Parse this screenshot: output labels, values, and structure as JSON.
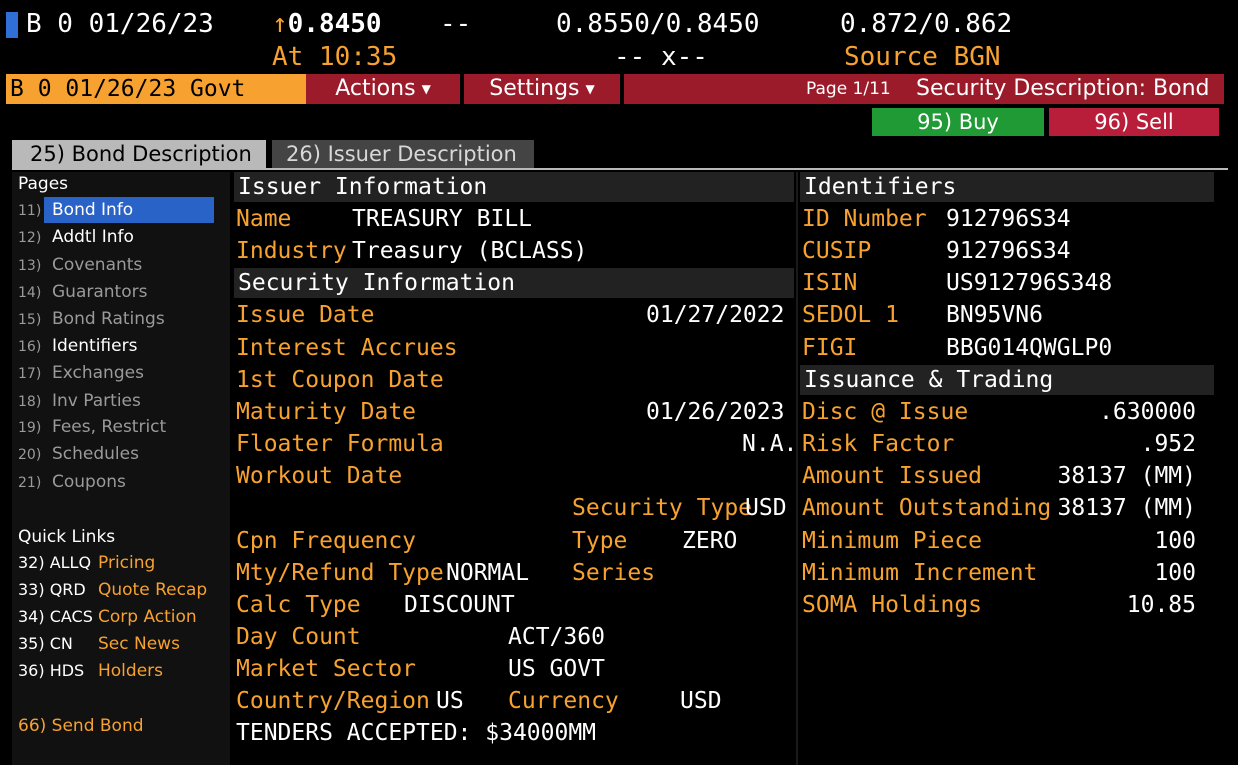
{
  "quote": {
    "ticker": "B 0 01/26/23",
    "arrow": "↑",
    "last_price": "0.8450",
    "change": "--",
    "time_label": "At 10:35",
    "bid": "0.8550",
    "ask": "0.8450",
    "bid_ask_sep": "/",
    "size_line": "-- x--",
    "yield_bid": "0.872",
    "yield_ask": "0.862",
    "source_label": "Source BGN"
  },
  "command_bar": {
    "security": "B 0 01/26/23 Govt",
    "actions": "Actions",
    "settings": "Settings",
    "page": "Page 1/11",
    "title": "Security Description: Bond",
    "buy": "95) Buy",
    "sell": "96) Sell",
    "accent": "#f7a230",
    "bar_color": "#9b1b2a"
  },
  "tabs": [
    {
      "label": "25) Bond Description",
      "active": true
    },
    {
      "label": "26) Issuer Description",
      "active": false
    }
  ],
  "sidebar": {
    "pages_label": "Pages",
    "pages": [
      {
        "num": "11)",
        "label": "Bond Info"
      },
      {
        "num": "12)",
        "label": "Addtl Info"
      },
      {
        "num": "13)",
        "label": "Covenants"
      },
      {
        "num": "14)",
        "label": "Guarantors"
      },
      {
        "num": "15)",
        "label": "Bond Ratings"
      },
      {
        "num": "16)",
        "label": "Identifiers"
      },
      {
        "num": "17)",
        "label": "Exchanges"
      },
      {
        "num": "18)",
        "label": "Inv Parties"
      },
      {
        "num": "19)",
        "label": "Fees, Restrict"
      },
      {
        "num": "20)",
        "label": "Schedules"
      },
      {
        "num": "21)",
        "label": "Coupons"
      }
    ],
    "quick_links_label": "Quick Links",
    "quick_links": [
      {
        "code": "32) ALLQ",
        "label": "Pricing"
      },
      {
        "code": "33) QRD",
        "label": "Quote Recap"
      },
      {
        "code": "34) CACS",
        "label": "Corp Action"
      },
      {
        "code": "35) CN",
        "label": "Sec News"
      },
      {
        "code": "36) HDS",
        "label": "Holders"
      }
    ],
    "send_bond": "66) Send Bond"
  },
  "issuer": {
    "header": "Issuer Information",
    "name_label": "Name",
    "name": "TREASURY BILL",
    "industry_label": "Industry",
    "industry": "Treasury (BCLASS)"
  },
  "security": {
    "header": "Security Information",
    "issue_date_label": "Issue Date",
    "issue_date": "01/27/2022",
    "interest_accrues_label": "Interest Accrues",
    "first_coupon_label": "1st Coupon Date",
    "maturity_label": "Maturity Date",
    "maturity": "01/26/2023",
    "floater_label": "Floater Formula",
    "floater": "N.A.",
    "workout_label": "Workout Date",
    "sec_type_label": "Security Type",
    "sec_type": "USD",
    "cpn_freq_label": "Cpn Frequency",
    "type_label": "Type",
    "type": "ZERO",
    "mty_label": "Mty/Refund Type",
    "mty": "NORMAL",
    "series_label": "Series",
    "calc_label": "Calc Type",
    "calc": "DISCOUNT",
    "day_count_label": "Day Count",
    "day_count": "ACT/360",
    "market_sector_label": "Market Sector",
    "market_sector": "US GOVT",
    "country_label": "Country/Region",
    "country": "US",
    "currency_label": "Currency",
    "currency": "USD",
    "tenders": "TENDERS ACCEPTED: $34000MM"
  },
  "identifiers": {
    "header": "Identifiers",
    "rows": [
      {
        "label": "ID Number",
        "value": "912796S34"
      },
      {
        "label": "CUSIP",
        "value": "912796S34"
      },
      {
        "label": "ISIN",
        "value": "US912796S348"
      },
      {
        "label": "SEDOL 1",
        "value": "BN95VN6"
      },
      {
        "label": "FIGI",
        "value": "BBG014QWGLP0"
      }
    ]
  },
  "issuance": {
    "header": "Issuance & Trading",
    "rows": [
      {
        "label": "Disc @ Issue",
        "value": ".630000"
      },
      {
        "label": "Risk Factor",
        "value": ".952"
      },
      {
        "label": "Amount Issued",
        "value": "38137 (MM)"
      },
      {
        "label": "Amount Outstanding",
        "value": "38137 (MM)"
      },
      {
        "label": "Minimum Piece",
        "value": "100"
      },
      {
        "label": "Minimum Increment",
        "value": "100"
      },
      {
        "label": "SOMA Holdings",
        "value": "10.85"
      }
    ]
  }
}
